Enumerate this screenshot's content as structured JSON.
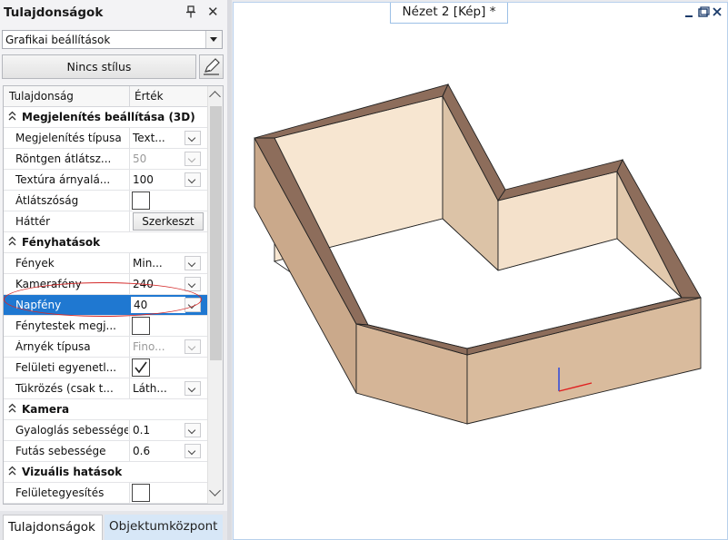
{
  "panel": {
    "title": "Tulajdonságok",
    "combo_value": "Grafikai beállítások",
    "style_button": "Nincs stílus",
    "columns": {
      "property": "Tulajdonság",
      "value": "Érték"
    },
    "categories": {
      "display": "Megjelenítés beállítása (3D)",
      "light": "Fényhatások",
      "camera": "Kamera",
      "visual": "Vizuális hatások"
    },
    "rows": {
      "display_type": {
        "label": "Megjelenítés típusa",
        "value": "Text..."
      },
      "xray": {
        "label": "Röntgen átlátsz...",
        "value": "50"
      },
      "texture_shade": {
        "label": "Textúra árnyalá...",
        "value": "100"
      },
      "transparency": {
        "label": "Átlátszóság"
      },
      "background": {
        "label": "Háttér",
        "button": "Szerkeszt"
      },
      "lights": {
        "label": "Fények",
        "value": "Min..."
      },
      "camera_light": {
        "label": "Kamerafény",
        "value": "240"
      },
      "sunlight": {
        "label": "Napfény",
        "value": "40"
      },
      "light_fixtures": {
        "label": "Fénytestek megj..."
      },
      "shadow_type": {
        "label": "Árnyék típusa",
        "value": "Fino..."
      },
      "surface_unevenness": {
        "label": "Felületi egyenetl..."
      },
      "reflection": {
        "label": "Tükrözés (csak t...",
        "value": "Láth..."
      },
      "walk_speed": {
        "label": "Gyaloglás sebessége",
        "value": "0.1"
      },
      "run_speed": {
        "label": "Futás sebessége",
        "value": "0.6"
      },
      "surface_merge": {
        "label": "Felületegyesítés"
      }
    },
    "tabs": {
      "properties": "Tulajdonságok",
      "object_center": "Objektumközpont"
    }
  },
  "view": {
    "tab_label": "Nézet 2 [Kép] *"
  },
  "colors": {
    "selection": "#1f78d1",
    "highlight_ellipse": "#d42a2a",
    "wall_side": "#d2b294",
    "wall_inner": "#f5e3cc",
    "wall_top": "#8e6e5e"
  }
}
